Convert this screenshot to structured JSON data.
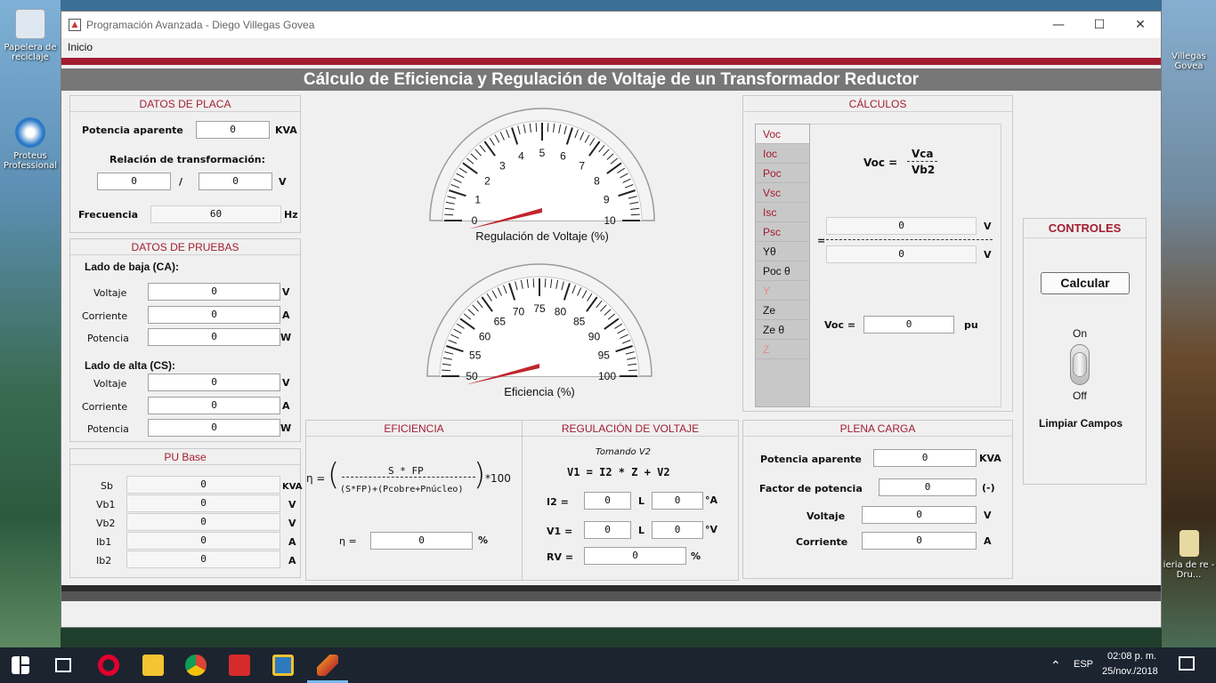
{
  "desktop": {
    "left_icons": [
      "Papelera de reciclaje",
      "Proteus Professional"
    ],
    "right_icons": [
      "Villegas Govea",
      "ieria de re - Dru..."
    ]
  },
  "window": {
    "title": "Programación Avanzada - Diego Villegas Govea",
    "controls": {
      "minimize": "—",
      "maximize": "☐",
      "close": "✕"
    }
  },
  "menu": {
    "inicio": "Inicio"
  },
  "header": {
    "title": "Cálculo de Eficiencia y Regulación de Voltaje de un Transformador Reductor"
  },
  "datos_placa": {
    "title": "DATOS DE PLACA",
    "potencia_label": "Potencia aparente",
    "potencia_value": "0",
    "potencia_unit": "KVA",
    "relacion_label": "Relación de transformación:",
    "relacion_a": "0",
    "relacion_sep": "/",
    "relacion_b": "0",
    "relacion_unit": "V",
    "frecuencia_label": "Frecuencia",
    "frecuencia_value": "60",
    "frecuencia_unit": "Hz"
  },
  "datos_pruebas": {
    "title": "DATOS DE PRUEBAS",
    "baja_title": "Lado de baja (CA):",
    "alta_title": "Lado de alta (CS):",
    "baja": [
      {
        "label": "Voltaje",
        "value": "0",
        "unit": "V"
      },
      {
        "label": "Corriente",
        "value": "0",
        "unit": "A"
      },
      {
        "label": "Potencia",
        "value": "0",
        "unit": "W"
      }
    ],
    "alta": [
      {
        "label": "Voltaje",
        "value": "0",
        "unit": "V"
      },
      {
        "label": "Corriente",
        "value": "0",
        "unit": "A"
      },
      {
        "label": "Potencia",
        "value": "0",
        "unit": "W"
      }
    ]
  },
  "pu_base": {
    "title": "PU Base",
    "rows": [
      {
        "label": "Sb",
        "value": "0",
        "unit": "KVA"
      },
      {
        "label": "Vb1",
        "value": "0",
        "unit": "V"
      },
      {
        "label": "Vb2",
        "value": "0",
        "unit": "V"
      },
      {
        "label": "Ib1",
        "value": "0",
        "unit": "A"
      },
      {
        "label": "Ib2",
        "value": "0",
        "unit": "A"
      }
    ]
  },
  "gauges": {
    "regulacion": {
      "caption": "Regulación de Voltaje (%)",
      "ticks": [
        "0",
        "1",
        "2",
        "3",
        "4",
        "5",
        "6",
        "7",
        "8",
        "9",
        "10"
      ],
      "min": 0,
      "max": 10,
      "value": 0
    },
    "eficiencia": {
      "caption": "Eficiencia (%)",
      "ticks": [
        "50",
        "55",
        "60",
        "65",
        "70",
        "75",
        "80",
        "85",
        "90",
        "95",
        "100"
      ],
      "min": 50,
      "max": 100,
      "value": 50
    }
  },
  "eficiencia": {
    "title": "EFICIENCIA",
    "eta_symbol": "η =",
    "numerator": "S * FP",
    "denominator": "(S*FP)+(Pcobre+Pnúcleo)",
    "times": "*100",
    "result_label": "η =",
    "result_value": "0",
    "result_unit": "%"
  },
  "regulacion": {
    "title": "REGULACIÓN DE VOLTAJE",
    "subtitle": "Tomando V2",
    "formula": "V1 = I2 * Z + V2",
    "i2_label": "I2 =",
    "i2_mag": "0",
    "i2_L": "L",
    "i2_ang": "0",
    "i2_unit": "°A",
    "v1_label": "V1 =",
    "v1_mag": "0",
    "v1_L": "L",
    "v1_ang": "0",
    "v1_unit": "°V",
    "rv_label": "RV =",
    "rv_value": "0",
    "rv_unit": "%"
  },
  "calculos": {
    "title": "CÁLCULOS",
    "items": [
      "Voc",
      "Ioc",
      "Poc",
      "Vsc",
      "Isc",
      "Psc",
      "Yθ",
      "Poc θ",
      "Y",
      "Ze",
      "Ze θ",
      "Z"
    ],
    "formula_lhs": "Voc  =",
    "formula_num": "Vca",
    "formula_den": "Vb2",
    "eq_sign": "=",
    "num_value": "0",
    "num_unit": "V",
    "den_value": "0",
    "den_unit": "V",
    "pu_label": "Voc  =",
    "pu_value": "0",
    "pu_unit": "pu"
  },
  "controles": {
    "title": "CONTROLES",
    "calcular": "Calcular",
    "on": "On",
    "off": "Off",
    "limpiar": "Limpiar Campos"
  },
  "plena_carga": {
    "title": "PLENA CARGA",
    "rows": [
      {
        "label": "Potencia aparente",
        "value": "0",
        "unit": "KVA"
      },
      {
        "label": "Factor de potencia",
        "value": "0",
        "unit": "(-)"
      },
      {
        "label": "Voltaje",
        "value": "0",
        "unit": "V"
      },
      {
        "label": "Corriente",
        "value": "0",
        "unit": "A"
      }
    ]
  },
  "taskbar": {
    "lang": "ESP",
    "time": "02:08 p. m.",
    "date": "25/nov./2018"
  }
}
